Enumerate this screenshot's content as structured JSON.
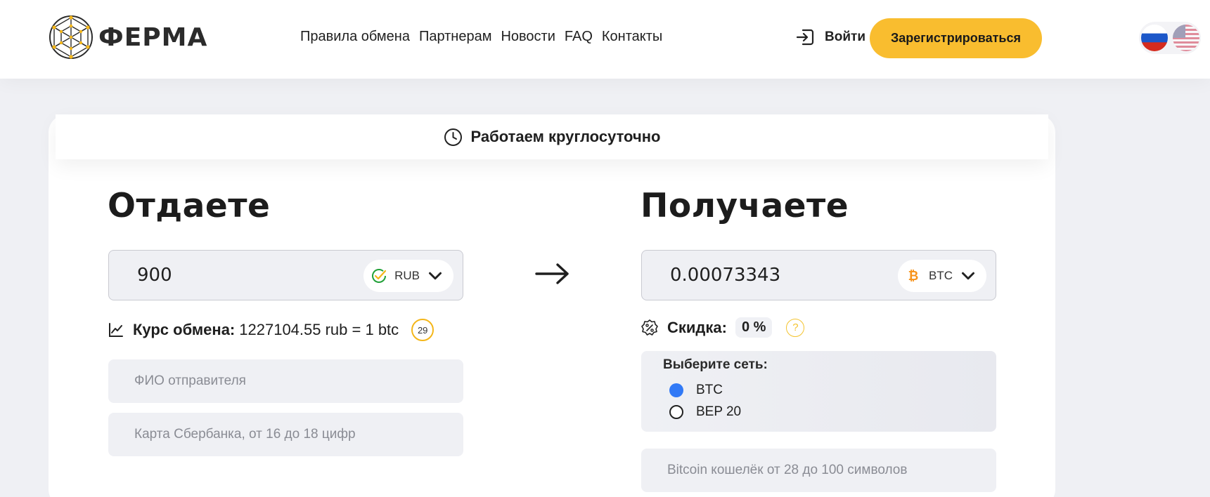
{
  "header": {
    "logo_text": "ФЕРМА",
    "nav": [
      "Правила обмена",
      "Партнерам",
      "Новости",
      "FAQ",
      "Контакты"
    ],
    "login_label": "Войти",
    "register_label": "Зарегистрироваться",
    "languages": [
      "ru-flag-icon",
      "us-flag-icon"
    ]
  },
  "banner": {
    "text": "Работаем круглосуточно",
    "icon": "clock-icon"
  },
  "give": {
    "heading": "Отдаете",
    "amount": "900",
    "currency": "RUB",
    "currency_icon": "sberbank-check-icon",
    "rate_title": "Курс обмена:",
    "rate_value": "1227104.55 rub = 1 btc",
    "timer": "29",
    "sender_name_placeholder": "ФИО отправителя",
    "card_placeholder": "Карта Сбербанка, от 16 до 18 цифр"
  },
  "receive": {
    "heading": "Получаете",
    "amount": "0.00073343",
    "currency": "BTC",
    "currency_icon": "bitcoin-icon",
    "discount_title": "Скидка:",
    "discount_value": "0 %",
    "help": "?",
    "network_title": "Выберите сеть:",
    "networks": [
      {
        "label": "BTC",
        "checked": true
      },
      {
        "label": "BEP 20",
        "checked": false
      }
    ],
    "wallet_placeholder": "Bitcoin кошелёк от 28 до 100 символов"
  },
  "colors": {
    "accent": "#f9bd2f",
    "radio_selected": "#3179f6",
    "background": "#eff0f4"
  }
}
